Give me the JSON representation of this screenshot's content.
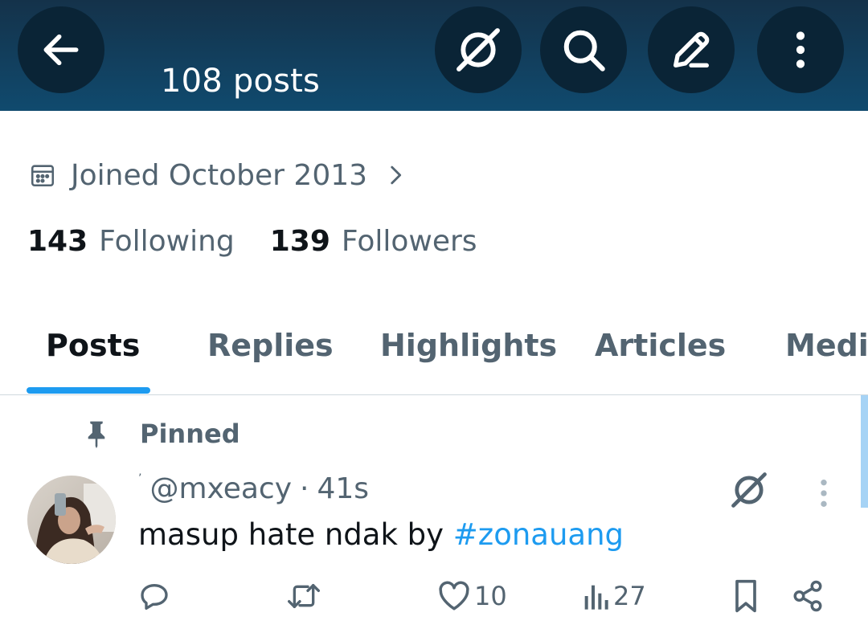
{
  "header": {
    "post_count": "108 posts",
    "icons": [
      "back-arrow-icon",
      "grok-icon",
      "search-icon",
      "compose-icon",
      "more-vertical-icon"
    ]
  },
  "profile": {
    "joined": "Joined October 2013",
    "following_count": "143",
    "following_label": "Following",
    "followers_count": "139",
    "followers_label": "Followers"
  },
  "tabs": [
    {
      "label": "Posts",
      "active": true
    },
    {
      "label": "Replies",
      "active": false
    },
    {
      "label": "Highlights",
      "active": false
    },
    {
      "label": "Articles",
      "active": false
    },
    {
      "label": "Media",
      "active": false
    }
  ],
  "post": {
    "pinned_label": "Pinned",
    "handle": "@mxeacy",
    "separator": "·",
    "time": "41s",
    "text": "masup hate ndak by ",
    "hashtag": "#zonauang",
    "likes": "10",
    "views": "27"
  },
  "colors": {
    "header_top": "#14324a",
    "header_bottom": "#104a6e",
    "accent": "#1d9bf0",
    "secondary_text": "#536471",
    "primary_text": "#0f1419"
  }
}
